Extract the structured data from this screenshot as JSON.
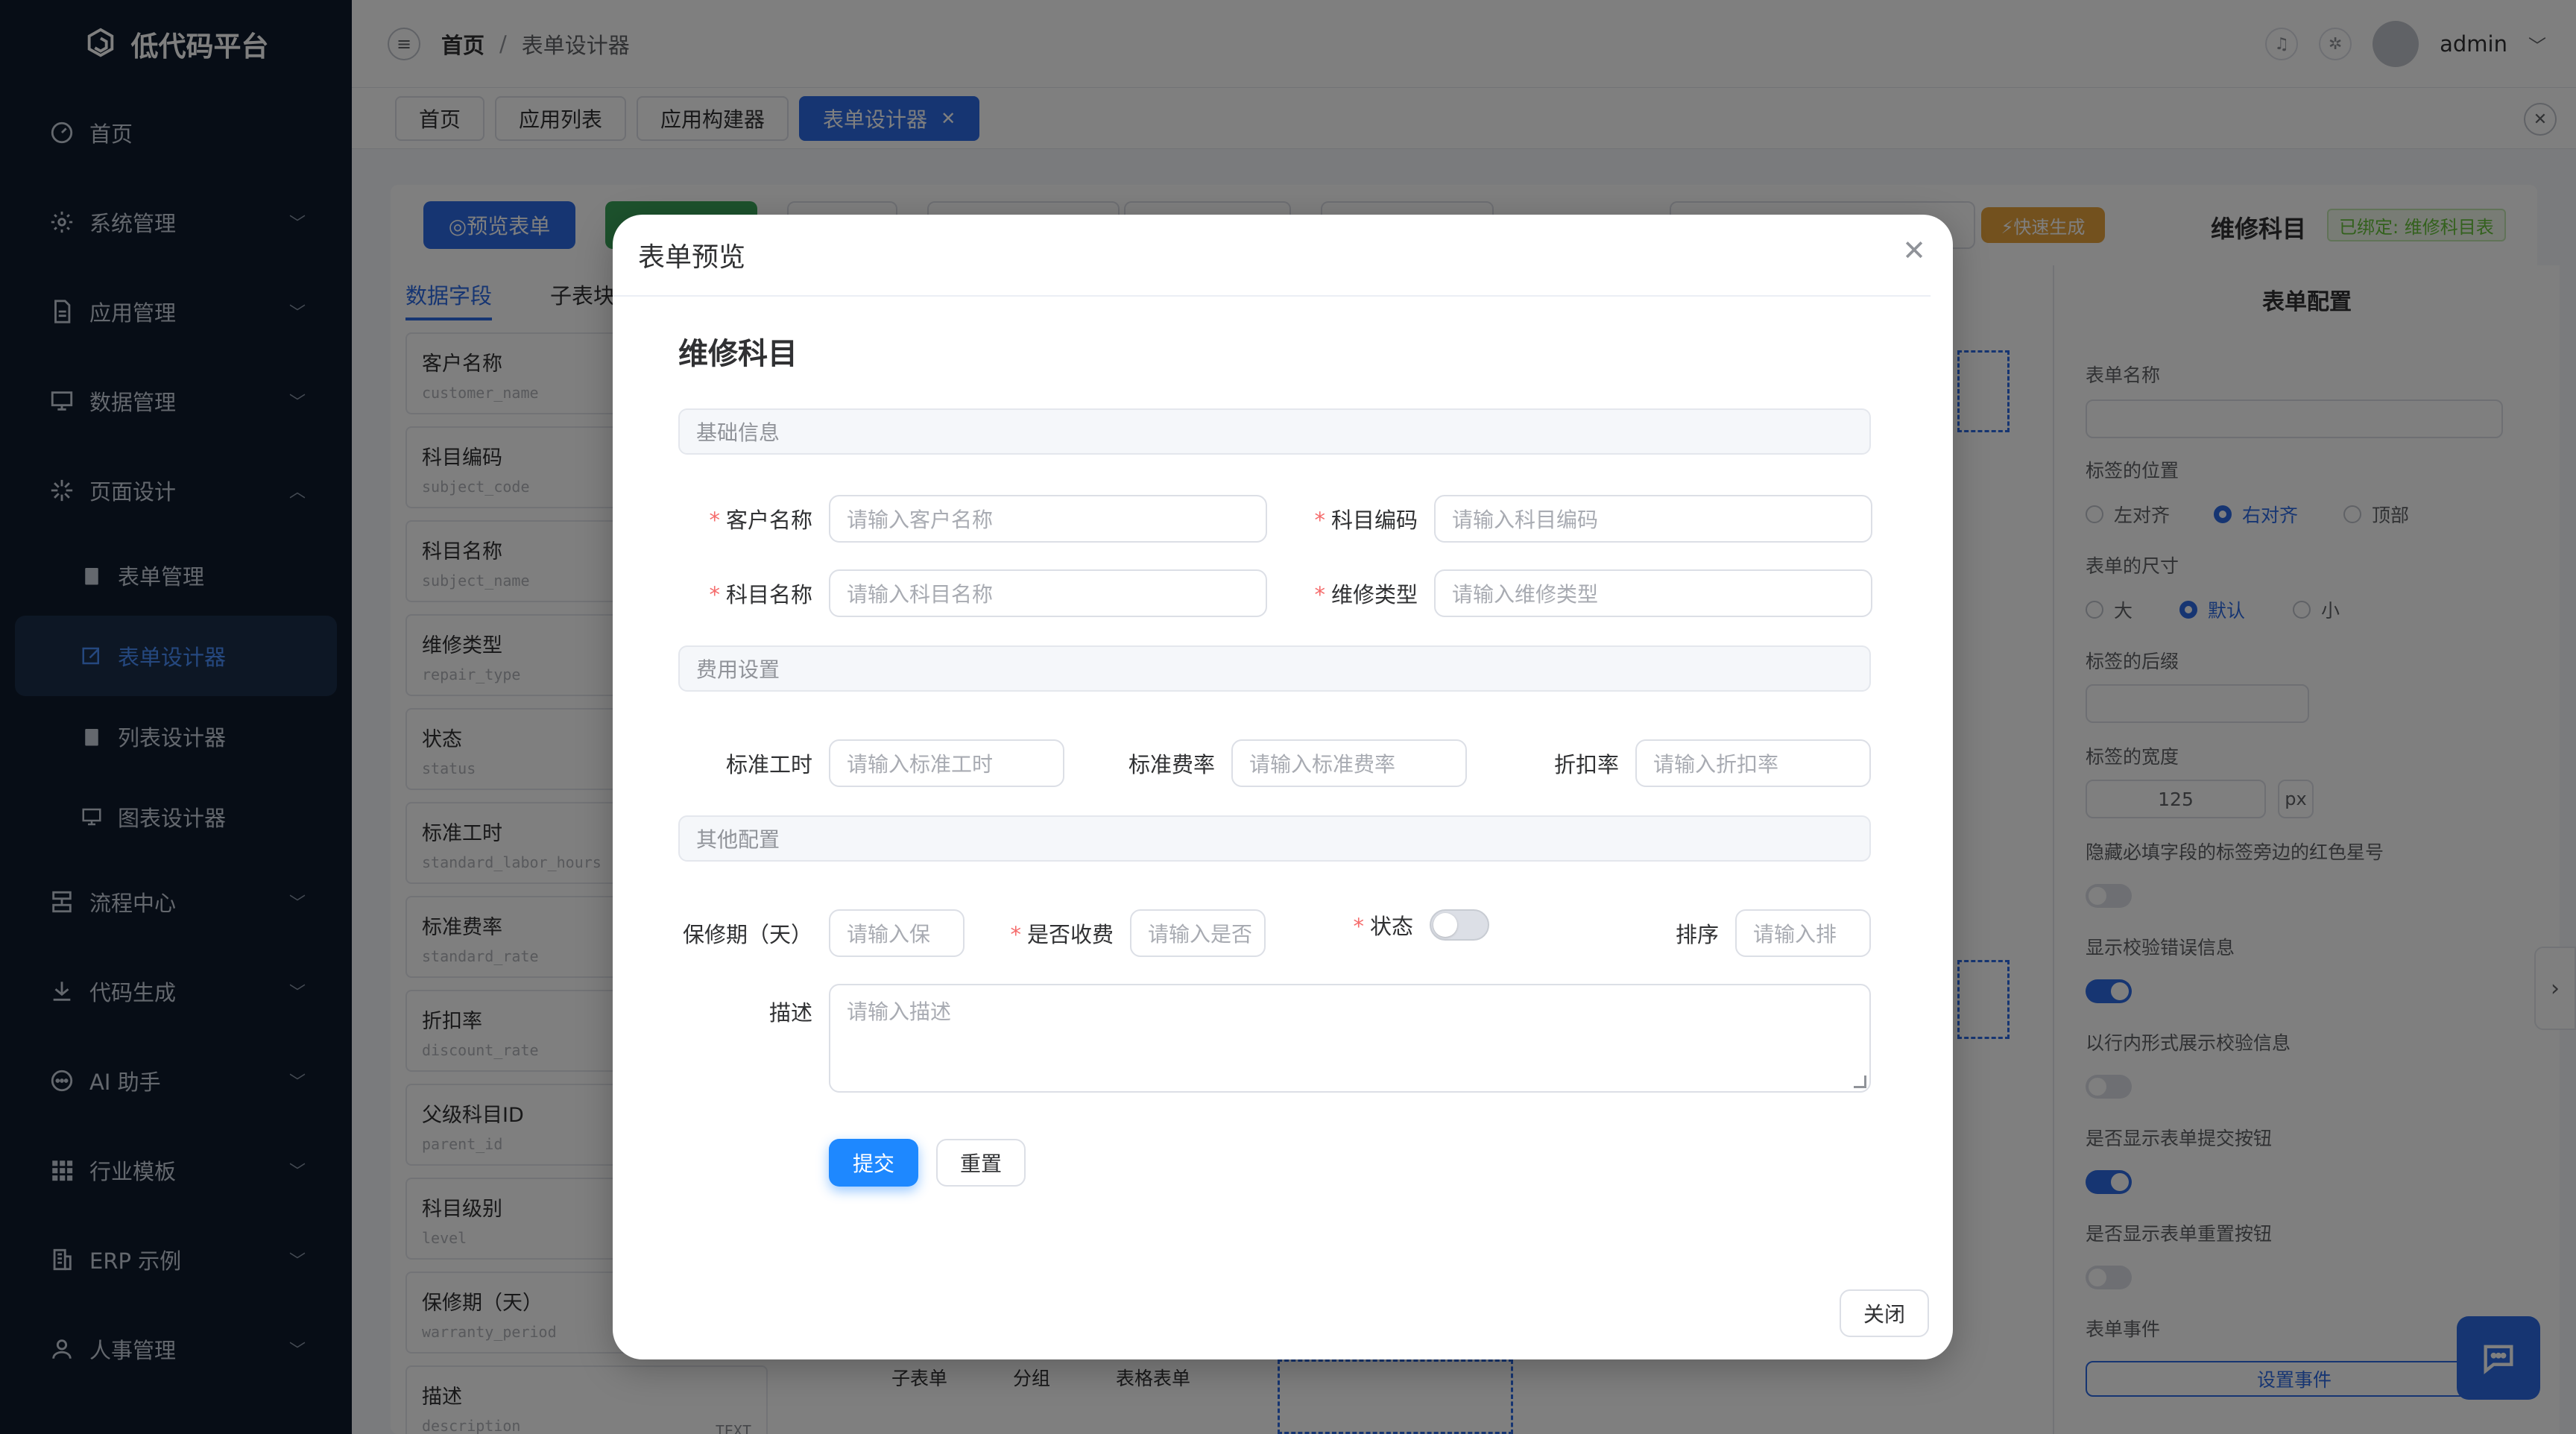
{
  "app": {
    "title": "低代码平台"
  },
  "sidebar": {
    "items": [
      {
        "label": "首页",
        "icon": "dashboard-icon"
      },
      {
        "label": "系统管理",
        "icon": "gear-icon"
      },
      {
        "label": "应用管理",
        "icon": "document-icon"
      },
      {
        "label": "数据管理",
        "icon": "monitor-icon"
      },
      {
        "label": "页面设计",
        "icon": "sparkle-icon",
        "expanded": true
      }
    ],
    "sub_items": [
      {
        "label": "表单管理",
        "icon": "clipboard-icon"
      },
      {
        "label": "表单设计器",
        "icon": "edit-icon",
        "active": true
      },
      {
        "label": "列表设计器",
        "icon": "clipboard-icon"
      },
      {
        "label": "图表设计器",
        "icon": "chart-icon"
      }
    ],
    "items_after": [
      {
        "label": "流程中心",
        "icon": "flow-icon"
      },
      {
        "label": "代码生成",
        "icon": "download-icon"
      },
      {
        "label": "AI 助手",
        "icon": "chat-icon"
      },
      {
        "label": "行业模板",
        "icon": "grid-icon"
      },
      {
        "label": "ERP 示例",
        "icon": "building-icon"
      },
      {
        "label": "人事管理",
        "icon": "user-icon"
      }
    ]
  },
  "header": {
    "breadcrumb_home": "首页",
    "breadcrumb_sep": "/",
    "breadcrumb_current": "表单设计器",
    "user": "admin"
  },
  "tabs": [
    "首页",
    "应用列表",
    "应用构建器",
    "表单设计器"
  ],
  "designer": {
    "preview_label": "◎预览表单",
    "quick_label": "⚡快速生成",
    "form_name": "维修科目",
    "bound_tag": "已绑定: 维修科目表",
    "left_tabs": [
      "数据字段",
      "子表块"
    ],
    "fields": [
      {
        "label": "客户名称",
        "code": "customer_name",
        "type": ""
      },
      {
        "label": "科目编码",
        "code": "subject_code",
        "type": ""
      },
      {
        "label": "科目名称",
        "code": "subject_name",
        "type": ""
      },
      {
        "label": "维修类型",
        "code": "repair_type",
        "type": ""
      },
      {
        "label": "状态",
        "code": "status",
        "type": ""
      },
      {
        "label": "标准工时",
        "code": "standard_labor_hours",
        "type": ""
      },
      {
        "label": "标准费率",
        "code": "standard_rate",
        "type": ""
      },
      {
        "label": "折扣率",
        "code": "discount_rate",
        "type": ""
      },
      {
        "label": "父级科目ID",
        "code": "parent_id",
        "type": ""
      },
      {
        "label": "科目级别",
        "code": "level",
        "type": ""
      },
      {
        "label": "保修期（天）",
        "code": "warranty_period",
        "type": ""
      },
      {
        "label": "描述",
        "code": "description",
        "type": "TEXT"
      }
    ],
    "bottom_tabs": [
      "子表单",
      "分组",
      "表格表单"
    ],
    "config": {
      "title": "表单配置",
      "form_name_label": "表单名称",
      "label_position_label": "标签的位置",
      "label_position_options": [
        "左对齐",
        "右对齐",
        "顶部"
      ],
      "label_position_selected": 1,
      "form_size_label": "表单的尺寸",
      "form_size_options": [
        "大",
        "默认",
        "小"
      ],
      "form_size_selected": 1,
      "label_suffix_label": "标签的后缀",
      "label_width_label": "标签的宽度",
      "label_width_value": "125",
      "label_width_unit": "px",
      "hide_required_label": "隐藏必填字段的标签旁边的红色星号",
      "hide_required_on": false,
      "show_error_label": "显示校验错误信息",
      "show_error_on": true,
      "inline_error_label": "以行内形式展示校验信息",
      "inline_error_on": false,
      "show_submit_label": "是否显示表单提交按钮",
      "show_submit_on": true,
      "show_reset_label": "是否显示表单重置按钮",
      "show_reset_on": false,
      "events_label": "表单事件",
      "set_event_button": "设置事件"
    }
  },
  "dialog": {
    "title": "表单预览",
    "form_title": "维修科目",
    "sections": [
      "基础信息",
      "费用设置",
      "其他配置"
    ],
    "fields": {
      "customer_name": {
        "label": "客户名称",
        "placeholder": "请输入客户名称",
        "required": true
      },
      "subject_code": {
        "label": "科目编码",
        "placeholder": "请输入科目编码",
        "required": true
      },
      "subject_name": {
        "label": "科目名称",
        "placeholder": "请输入科目名称",
        "required": true
      },
      "repair_type": {
        "label": "维修类型",
        "placeholder": "请输入维修类型",
        "required": true
      },
      "standard_hours": {
        "label": "标准工时",
        "placeholder": "请输入标准工时"
      },
      "standard_rate": {
        "label": "标准费率",
        "placeholder": "请输入标准费率"
      },
      "discount_rate": {
        "label": "折扣率",
        "placeholder": "请输入折扣率"
      },
      "warranty": {
        "label": "保修期（天）",
        "placeholder": "请输入保"
      },
      "charged": {
        "label": "是否收费",
        "placeholder": "请输入是否",
        "required": true
      },
      "status": {
        "label": "状态",
        "required": true,
        "on": false
      },
      "sort": {
        "label": "排序",
        "placeholder": "请输入排"
      },
      "description": {
        "label": "描述",
        "placeholder": "请输入描述"
      }
    },
    "submit_label": "提交",
    "reset_label": "重置",
    "close_label": "关闭"
  },
  "colors": {
    "primary": "#2d6be4",
    "sidebar_bg": "#0f1b2d",
    "required": "#f56c6c",
    "submit": "#1e88ff"
  }
}
